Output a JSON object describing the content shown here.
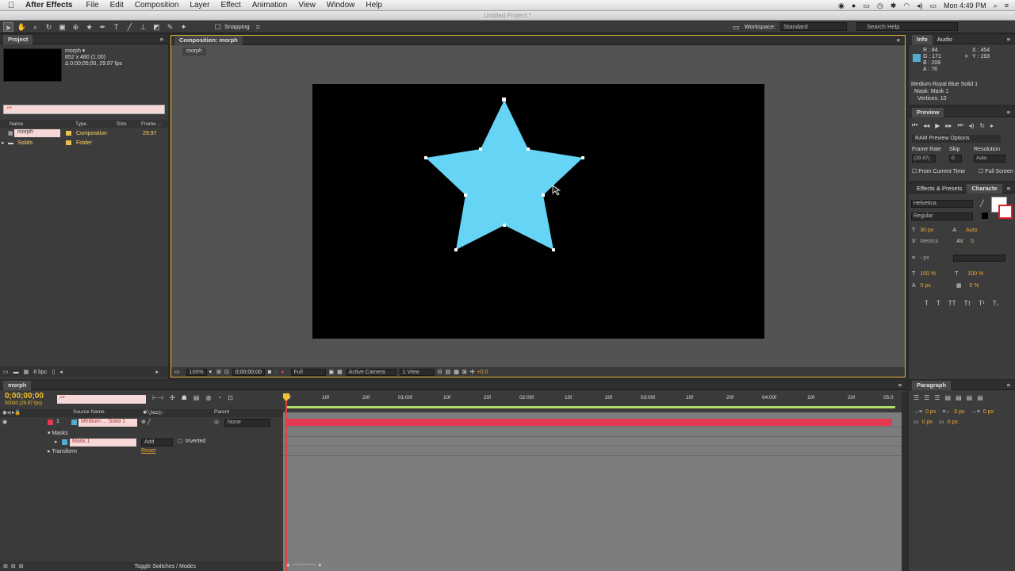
{
  "menubar": {
    "apple": "",
    "app_name": "After Effects",
    "items": [
      "File",
      "Edit",
      "Composition",
      "Layer",
      "Effect",
      "Animation",
      "View",
      "Window",
      "Help"
    ],
    "clock": "Mon 4:49 PM"
  },
  "titlebar": {
    "title": "Untitled Project *"
  },
  "toolbar": {
    "snapping_label": "Snapping",
    "workspace_label": "Workspace:",
    "workspace_value": "Standard",
    "search_placeholder": "Search Help"
  },
  "project_panel": {
    "tab": "Project",
    "thumb_name": "morph ▾",
    "thumb_size": "852 x 480 (1.00)",
    "thumb_duration": "Δ 0;00;05;00, 29.97 fps",
    "columns": [
      "Name",
      "Type",
      "Size",
      "Frame ..."
    ],
    "items": [
      {
        "name": "morph",
        "type": "Composition",
        "size": "",
        "frame": "29.97",
        "color": "#e8c24a"
      },
      {
        "name": "Solids",
        "type": "Folder",
        "size": "",
        "frame": "",
        "color": "#e8c24a"
      }
    ],
    "bpc": "8 bpc"
  },
  "comp_panel": {
    "tab": "Composition: morph",
    "breadcrumb": "morph",
    "zoom": "100%",
    "timecode": "0;00;00;00",
    "resolution": "Full",
    "camera": "Active Camera",
    "views": "1 View",
    "exposure": "+0.0"
  },
  "info_panel": {
    "tabs": [
      "Info",
      "Audio"
    ],
    "swatch_color": "#54abd0",
    "r": "R : 84",
    "g": "G : 171",
    "b": "B : 208",
    "a": "A : 78",
    "x": "X : 454",
    "y": "Y : 193",
    "layer": "Medium Royal Blue Solid 1",
    "mask": "Mask: Mask 1",
    "vertices": "Vertices: 10"
  },
  "preview_panel": {
    "tab": "Preview",
    "ram_options": "RAM Preview Options",
    "frame_rate_label": "Frame Rate",
    "skip_label": "Skip",
    "resolution_label": "Resolution",
    "frame_rate": "(29.97)",
    "skip": "0",
    "resolution": "Auto",
    "from_current": "From Current Time",
    "full_screen": "Full Screen"
  },
  "character_panel": {
    "tabs": [
      "Effects & Presets",
      "Characte"
    ],
    "font": "Helvetica",
    "style": "Regular",
    "size": "30 px",
    "leading": "Auto",
    "kerning": "Metrics",
    "tracking": "0",
    "stroke": "- px",
    "vscale": "100 %",
    "hscale": "100 %",
    "baseline": "0 px",
    "tsume": "0 %"
  },
  "paragraph_panel": {
    "tab": "Paragraph",
    "indent1": "0 px",
    "indent2": "0 px",
    "indent3": "0 px",
    "space1": "0 px",
    "space2": "0 px"
  },
  "timeline": {
    "tab": "morph",
    "timecode": "0;00;00;00",
    "fps": "00000 (29.97 fps)",
    "col_source": "Source Name",
    "col_parent": "Parent",
    "layer_num": "1",
    "layer_name": "Medium ... Solid 1",
    "parent": "None",
    "masks": "Masks",
    "mask1": "Mask 1",
    "mask_mode": "Add",
    "inverted": "Inverted",
    "transform": "Transform",
    "reset": "Reset",
    "toggle": "Toggle Switches / Modes",
    "ruler": [
      "0f",
      "10f",
      "20f",
      "01:00f",
      "10f",
      "20f",
      "02:00f",
      "10f",
      "20f",
      "03:00f",
      "10f",
      "20f",
      "04:00f",
      "10f",
      "20f",
      "05:0"
    ]
  },
  "colors": {
    "star": "#66d4f5",
    "layer_bar": "#e33a52",
    "work_area": "#aee06a",
    "highlight": "#f0c030",
    "playhead": "#e04040"
  }
}
